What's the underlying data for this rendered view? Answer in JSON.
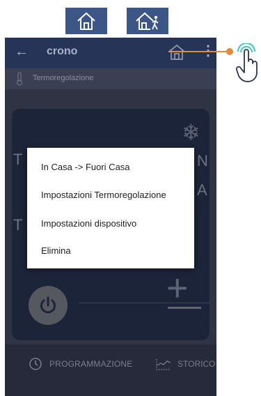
{
  "legend": {
    "icons": [
      "home-icon",
      "home-away-icon"
    ]
  },
  "appbar": {
    "back_icon": "back-arrow-icon",
    "title": "crono",
    "home_icon": "home-icon",
    "menu_icon": "more-vert-icon"
  },
  "subbar": {
    "icon": "thermometer-icon",
    "label": "Termoregolazione"
  },
  "panel": {
    "mode_icon": "snowflake-icon",
    "power_icon": "power-icon",
    "plus_icon": "plus-icon",
    "minus_icon": "minus-icon"
  },
  "bottom_nav": {
    "programming_label": "PROGRAMMAZIONE",
    "programming_icon": "clock-icon",
    "history_label": "STORICO",
    "history_icon": "chart-icon"
  },
  "menu": {
    "items": [
      "In Casa -> Fuori Casa",
      "Impostazioni Termoregolazione",
      "Impostazioni dispositivo",
      "Elimina"
    ]
  },
  "callout": {
    "color": "#e08a3c",
    "icon": "tap-hand-icon"
  },
  "colors": {
    "accent_blue": "#3d5688",
    "appbar": "#263457",
    "screen": "#24283b",
    "callout": "#e08a3c"
  }
}
